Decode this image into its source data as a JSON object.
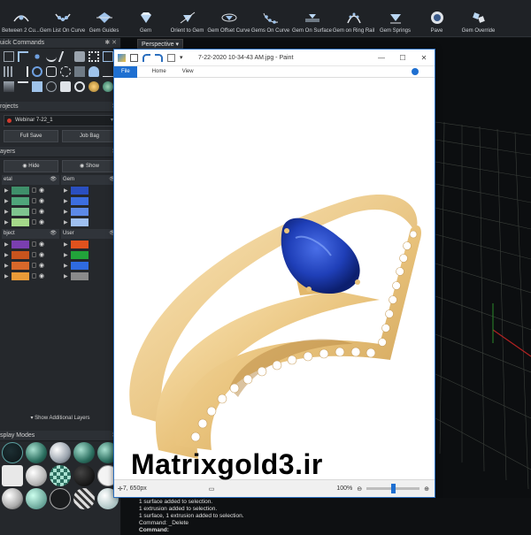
{
  "toolbar": {
    "items": [
      {
        "label": "Between 2 Cu...",
        "icon": "curve-between-icon"
      },
      {
        "label": "Gem List On Curve",
        "icon": "gem-list-curve-icon"
      },
      {
        "label": "Gem Guides",
        "icon": "gem-guides-icon"
      },
      {
        "label": "Gem",
        "icon": "gem-icon"
      },
      {
        "label": "Orient to Gem",
        "icon": "orient-gem-icon"
      },
      {
        "label": "Gem Offset Curve",
        "icon": "gem-offset-icon"
      },
      {
        "label": "Gems On Curve",
        "icon": "gems-on-curve-icon"
      },
      {
        "label": "Gem On Surface",
        "icon": "gem-surface-icon"
      },
      {
        "label": "Gem on Ring Rail",
        "icon": "gem-ring-rail-icon"
      },
      {
        "label": "Gem Springs",
        "icon": "gem-springs-icon"
      },
      {
        "label": "Pave",
        "icon": "pave-icon"
      },
      {
        "label": "Gem Override",
        "icon": "gem-override-icon"
      }
    ]
  },
  "left": {
    "quick_commands": "uick Commands",
    "projects": "rojects",
    "project_name": "Webinar 7-22_1",
    "full_save": "Full Save",
    "job_bag": "Job Bag",
    "layers": "ayers",
    "hide": "Hide",
    "show": "Show",
    "metal_header": "etal",
    "gem_header": "Gem",
    "object_header": "bject",
    "user_header": "User",
    "show_additional": "Show Additional Layers",
    "display_modes": "splay Modes",
    "colors": {
      "metal": [
        "#3f8f6a",
        "#4fa57a",
        "#7fc58f",
        "#a5d98a"
      ],
      "gem": [
        "#2a4fc0",
        "#3c6ee0",
        "#5c8ae8",
        "#9fc0f0"
      ],
      "object": [
        "#7a3fb0",
        "#c8541e",
        "#d8682a",
        "#e89b38"
      ],
      "user": [
        "#e0521e",
        "#22a33a",
        "#2f6be0",
        "#8a8a8a"
      ]
    }
  },
  "viewport": {
    "tab": "Perspective"
  },
  "paint": {
    "title": "7-22-2020 10-34-43 AM.jpg - Paint",
    "file_tab": "File",
    "home_tab": "Home",
    "view_tab": "View",
    "coords": "7, 650px",
    "zoom": "100%"
  },
  "watermark": "Matrixgold3.ir",
  "command": {
    "lines": [
      "1 surface added to selection.",
      "1 extrusion added to selection.",
      "1 surface, 1 extrusion added to selection.",
      "Command: _Delete"
    ],
    "prompt": "Command:"
  }
}
